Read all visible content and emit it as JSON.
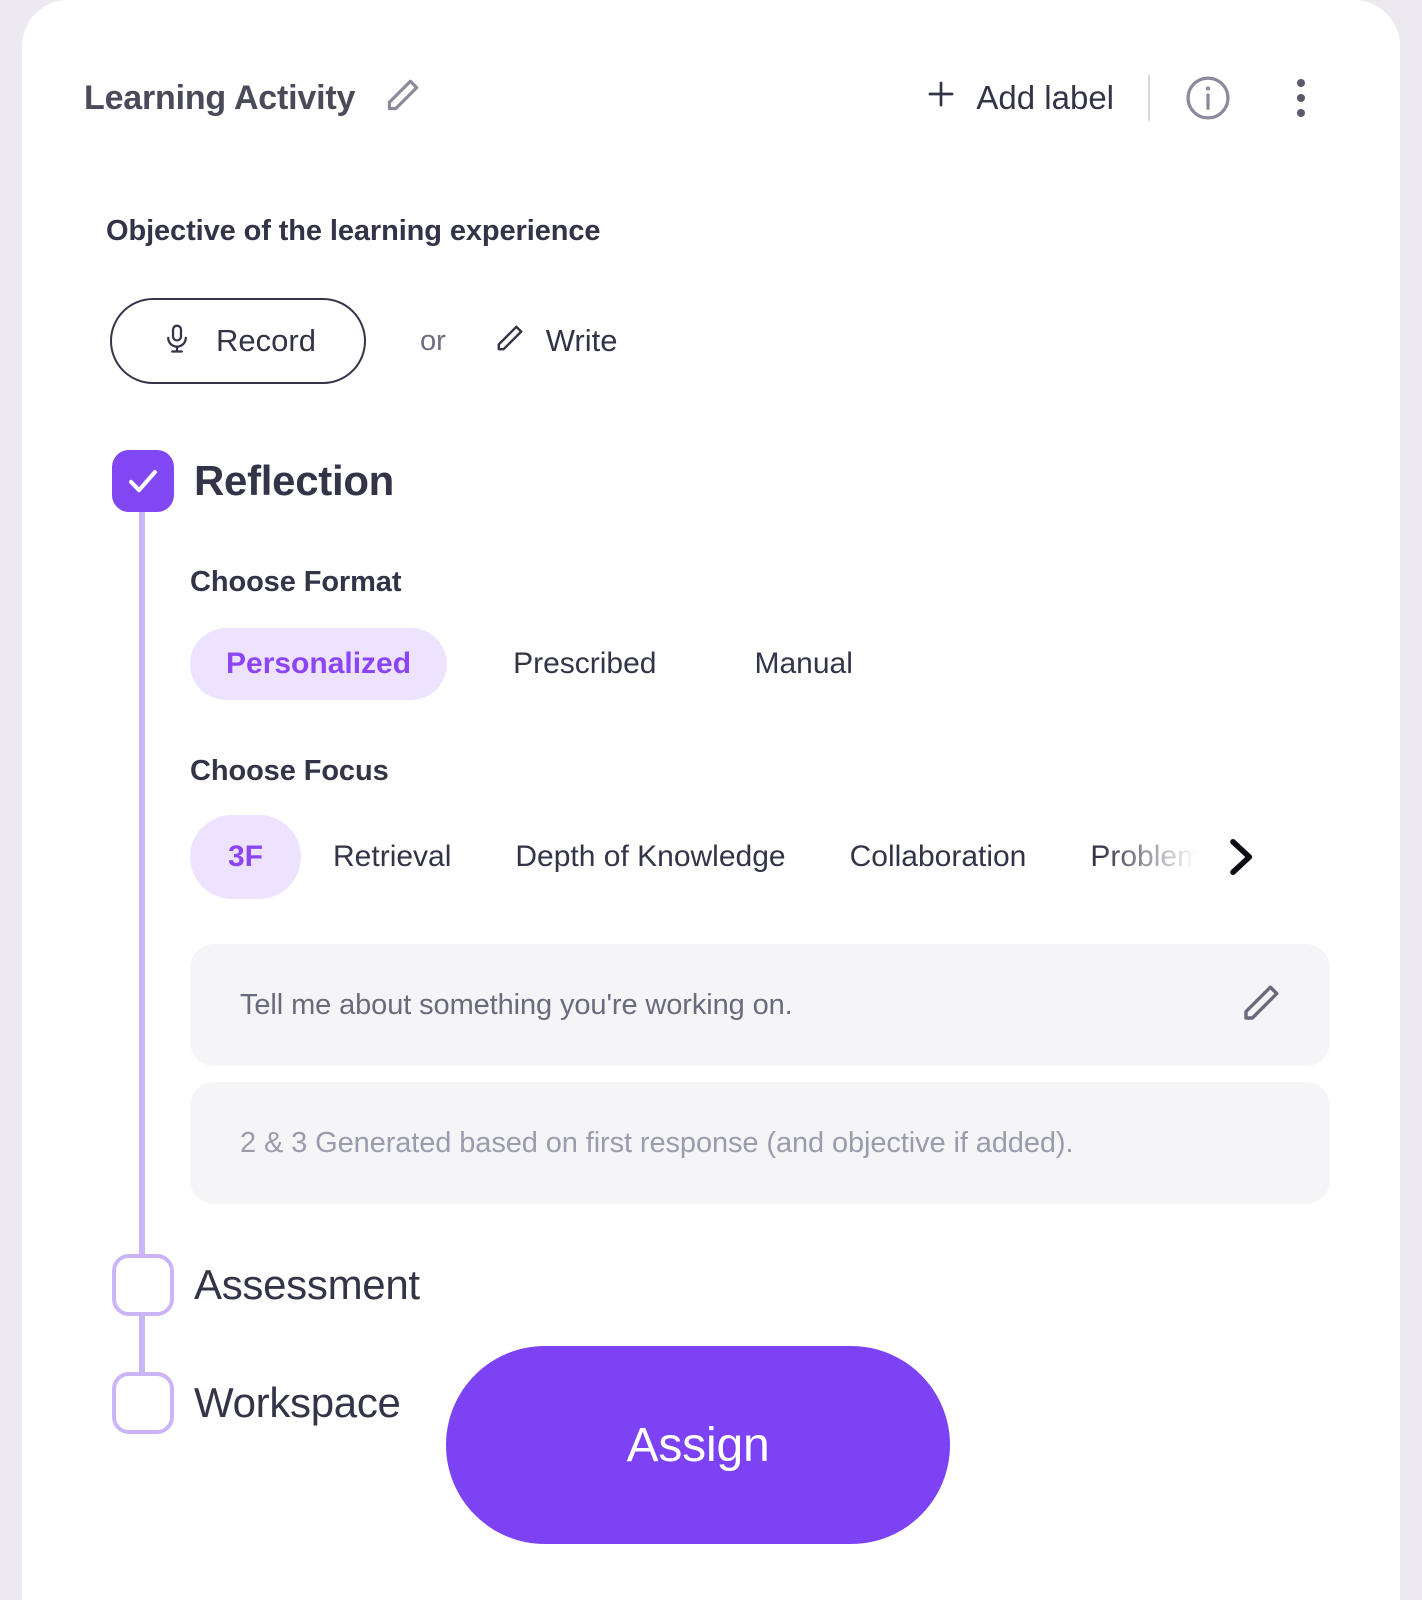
{
  "header": {
    "title": "Learning Activity",
    "edit_icon": "pencil-icon",
    "add_label": "Add label",
    "plus_icon": "plus-icon",
    "info_icon": "info-circle-icon",
    "more_icon": "kebab-menu-icon"
  },
  "objective": {
    "heading": "Objective of the learning experience",
    "record_label": "Record",
    "record_icon": "microphone-icon",
    "or_text": "or",
    "write_label": "Write",
    "write_icon": "pencil-icon"
  },
  "steps": [
    {
      "label": "Reflection",
      "checked": true
    },
    {
      "label": "Assessment",
      "checked": false
    },
    {
      "label": "Workspace",
      "checked": false
    }
  ],
  "reflection": {
    "format": {
      "heading": "Choose Format",
      "options": [
        "Personalized",
        "Prescribed",
        "Manual"
      ],
      "selected": "Personalized"
    },
    "focus": {
      "heading": "Choose Focus",
      "options": [
        "3F",
        "Retrieval",
        "Depth of Knowledge",
        "Collaboration",
        "Problem"
      ],
      "selected": "3F",
      "next_icon": "chevron-right-icon"
    },
    "prompts": [
      {
        "text": "Tell me about something you're working on.",
        "muted": false,
        "edit_icon": "pencil-icon"
      },
      {
        "text": "2 & 3 Generated based on first response (and objective if added).",
        "muted": true
      }
    ]
  },
  "assign": {
    "label": "Assign"
  },
  "colors": {
    "accent": "#7c42f4",
    "accent_text": "#8b45f5",
    "accent_soft": "#eee3fe",
    "tree_line": "#cbb5f7",
    "text": "#343449",
    "muted_text": "#9b9bae",
    "page_bg": "#eceaf0",
    "card_bg": "#ffffff",
    "field_bg": "#f5f5f7"
  }
}
